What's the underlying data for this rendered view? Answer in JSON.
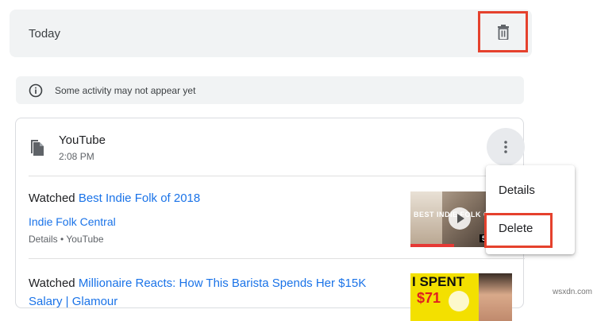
{
  "day": {
    "title": "Today"
  },
  "notice": {
    "text": "Some activity may not appear yet"
  },
  "card": {
    "title": "YouTube",
    "time": "2:08 PM",
    "items": [
      {
        "prefix": "Watched",
        "video_title": "Best Indie Folk of 2018",
        "channel": "Indie Folk Central",
        "meta": "Details • YouTube",
        "thumb_text": "BEST INDIE FOLK OF",
        "thumb_badge": "5"
      },
      {
        "prefix": "Watched",
        "video_title": "Millionaire Reacts: How This Barista Spends Her $15K Salary | Glamour",
        "thumb_line1": "I SPENT",
        "thumb_line2": "$71"
      }
    ]
  },
  "menu": {
    "items": [
      "Details",
      "Delete"
    ]
  },
  "watermark": "wsxdn.com",
  "colors": {
    "highlight": "#e5412d",
    "link": "#1a73e8",
    "background": "#f1f3f4"
  }
}
